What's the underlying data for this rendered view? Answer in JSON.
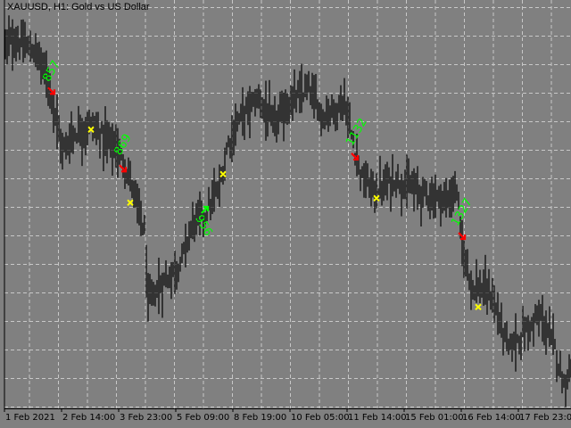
{
  "chart_data": {
    "type": "candlestick-bars",
    "title": "XAUUSD, H1:  Gold vs US Dollar",
    "symbol": "XAUUSD",
    "timeframe": "H1",
    "description": "Gold vs US Dollar",
    "x_tick_labels": [
      "1 Feb 2021",
      "2 Feb 14:00",
      "3 Feb 23:00",
      "5 Feb 09:00",
      "8 Feb 19:00",
      "10 Feb 05:00",
      "11 Feb 14:00",
      "15 Feb 01:00",
      "16 Feb 14:00",
      "17 Feb 23:00"
    ],
    "bars_per_tick": 32,
    "ylim": [
      1765,
      1875
    ],
    "grid": true,
    "price_path": [
      [
        0,
        1863
      ],
      [
        5,
        1864.2
      ],
      [
        18,
        1860.6
      ],
      [
        25,
        1852.2
      ],
      [
        32,
        1834.1
      ],
      [
        38,
        1838.9
      ],
      [
        48,
        1841.3
      ],
      [
        62,
        1835.3
      ],
      [
        68,
        1829.3
      ],
      [
        72,
        1823.3
      ],
      [
        78,
        1812.5
      ],
      [
        80,
        1793.3
      ],
      [
        85,
        1796.9
      ],
      [
        98,
        1804.1
      ],
      [
        105,
        1814.9
      ],
      [
        112,
        1817.3
      ],
      [
        120,
        1824.5
      ],
      [
        125,
        1836.5
      ],
      [
        132,
        1843.8
      ],
      [
        142,
        1848.6
      ],
      [
        150,
        1841.3
      ],
      [
        160,
        1847.4
      ],
      [
        170,
        1851
      ],
      [
        178,
        1843.8
      ],
      [
        190,
        1847.4
      ],
      [
        195,
        1836.5
      ],
      [
        200,
        1826.9
      ],
      [
        208,
        1823.3
      ],
      [
        218,
        1826.9
      ],
      [
        232,
        1823.3
      ],
      [
        248,
        1820.9
      ],
      [
        253,
        1824.5
      ],
      [
        256,
        1807.7
      ],
      [
        262,
        1798.1
      ],
      [
        272,
        1795.7
      ],
      [
        282,
        1781.2
      ],
      [
        292,
        1786.1
      ],
      [
        300,
        1789.7
      ],
      [
        308,
        1781.2
      ],
      [
        313,
        1771.6
      ],
      [
        317,
        1776.4
      ]
    ],
    "sell_arrows": [
      [
        26,
        1850.2
      ],
      [
        66,
        1829.3
      ],
      [
        196,
        1832.5
      ],
      [
        256,
        1811.1
      ]
    ],
    "buy_arrows": [
      [
        112,
        1818.8
      ]
    ],
    "exit_marks": [
      [
        48,
        1840.1
      ],
      [
        70,
        1820.4
      ],
      [
        122,
        1828.1
      ],
      [
        208,
        1821.6
      ],
      [
        265,
        1792.3
      ]
    ],
    "annotations": [
      {
        "text": "857",
        "bar": 26,
        "price": 1855.8,
        "angle": -60
      },
      {
        "text": "869",
        "bar": 66,
        "price": 1836,
        "angle": -60
      },
      {
        "text": "956",
        "bar": 111,
        "price": 1814.2,
        "angle": 60
      },
      {
        "text": "1132",
        "bar": 197,
        "price": 1839.4,
        "angle": -60
      },
      {
        "text": "1327",
        "bar": 256,
        "price": 1817.8,
        "angle": -60
      }
    ],
    "colors": {
      "background": "#808080",
      "bars": "#000000",
      "grid": "#c8c8c8",
      "sell": "#ff0000",
      "buy": "#00ff00",
      "exit": "#ffff00",
      "label": "#00ff00"
    }
  }
}
